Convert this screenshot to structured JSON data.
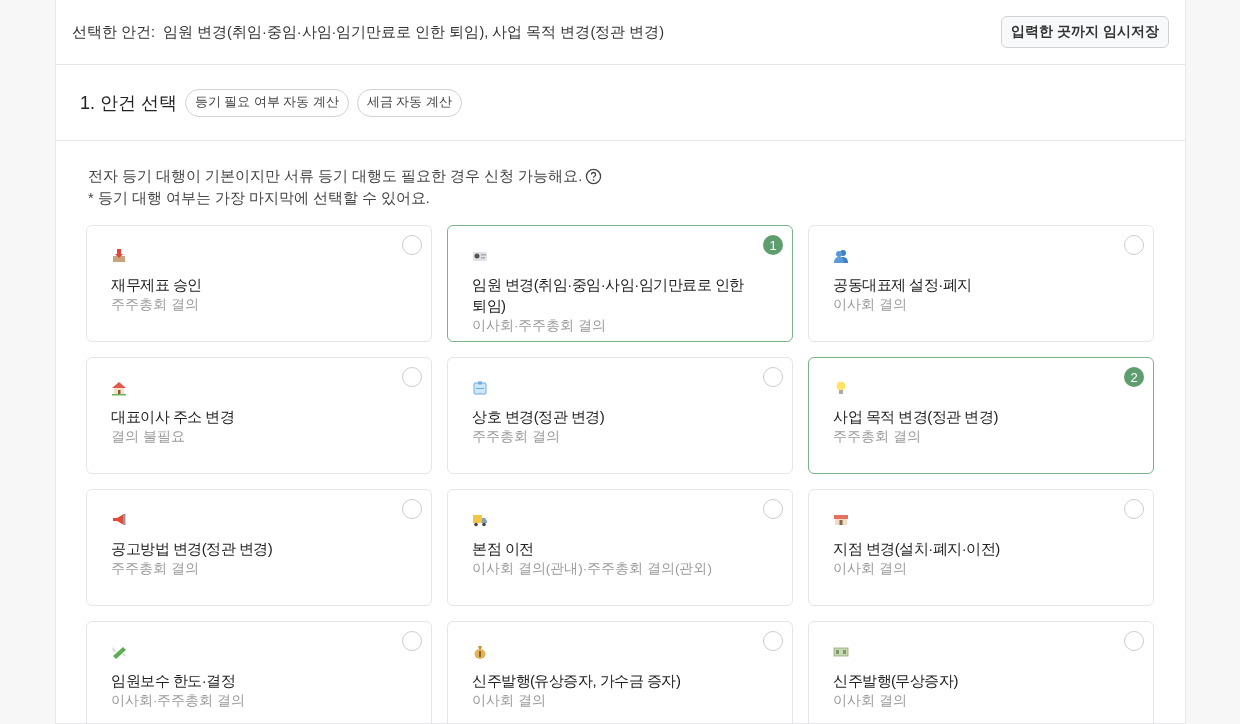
{
  "selection_bar": {
    "label": "선택한 안건:",
    "value": "임원 변경(취임·중임·사임·임기만료로 인한 퇴임), 사업 목적 변경(정관 변경)",
    "save_button": "입력한 곳까지 임시저장"
  },
  "section": {
    "title": "1. 안건 선택",
    "chips": [
      "등기 필요 여부 자동 계산",
      "세금 자동 계산"
    ]
  },
  "info": {
    "lines": [
      "전자 등기 대행이 기본이지만 서류 등기 대행도 필요한 경우 신청 가능해요.",
      "* 등기 대행 여부는 가장 마지막에 선택할 수 있어요."
    ]
  },
  "agenda_cards": [
    {
      "title": "재무제표 승인",
      "note": "주주총회 결의",
      "selected": false
    },
    {
      "title": "임원 변경(취임·중임·사임·임기만료로 인한 퇴임)",
      "note": "이사회·주주총회 결의",
      "selected": true,
      "order": "1"
    },
    {
      "title": "공동대표제 설정·폐지",
      "note": "이사회 결의",
      "selected": false
    },
    {
      "title": "대표이사 주소 변경",
      "note": "결의 불필요",
      "selected": false
    },
    {
      "title": "상호 변경(정관 변경)",
      "note": "주주총회 결의",
      "selected": false
    },
    {
      "title": "사업 목적 변경(정관 변경)",
      "note": "주주총회 결의",
      "selected": true,
      "order": "2"
    },
    {
      "title": "공고방법 변경(정관 변경)",
      "note": "주주총회 결의",
      "selected": false
    },
    {
      "title": "본점 이전",
      "note": "이사회 결의(관내)·주주총회 결의(관외)",
      "selected": false
    },
    {
      "title": "지점 변경(설치·폐지·이전)",
      "note": "이사회 결의",
      "selected": false
    },
    {
      "title": "임원보수 한도·결정",
      "note": "이사회·주주총회 결의",
      "selected": false
    },
    {
      "title": "신주발행(유상증자, 가수금 증자)",
      "note": "이사회 결의",
      "selected": false
    },
    {
      "title": "신주발행(무상증자)",
      "note": "이사회 결의",
      "selected": false
    }
  ]
}
